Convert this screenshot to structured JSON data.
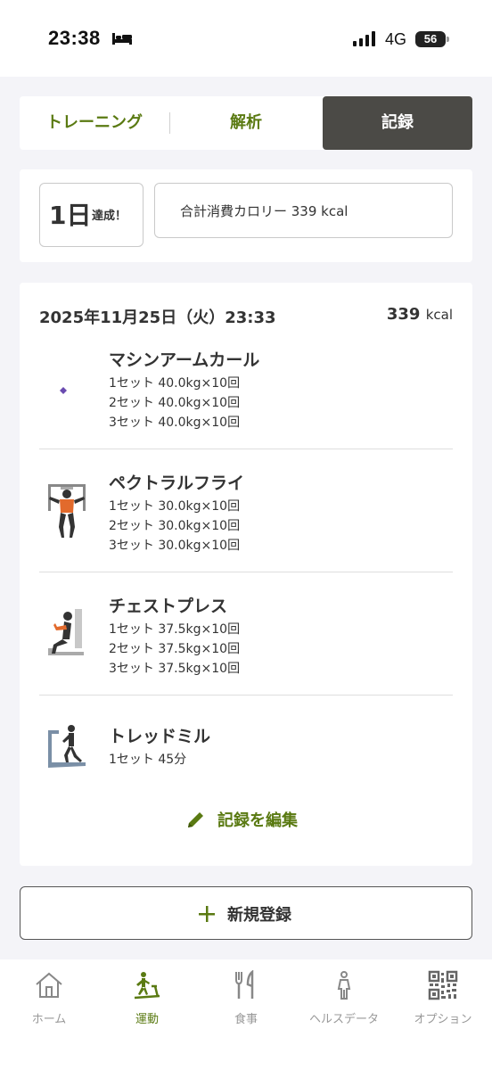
{
  "status_bar": {
    "time": "23:38",
    "network": "4G",
    "battery": "56",
    "icons": [
      "bed-icon",
      "signal-icon",
      "battery-icon"
    ]
  },
  "tabs": [
    {
      "label": "トレーニング",
      "active": false
    },
    {
      "label": "解析",
      "active": false
    },
    {
      "label": "記録",
      "active": true
    }
  ],
  "achievement": {
    "days": "1日",
    "suffix": "達成！",
    "calories_text": "合計消費カロリー 339 kcal"
  },
  "record": {
    "datetime": "2025年11月25日（火）23:33",
    "kcal_value": "339",
    "kcal_unit": "kcal",
    "exercises": [
      {
        "name": "マシンアームカール",
        "icon": "arm-curl-icon",
        "sets": [
          "1セット 40.0kg×10回",
          "2セット 40.0kg×10回",
          "3セット 40.0kg×10回"
        ]
      },
      {
        "name": "ペクトラルフライ",
        "icon": "pectoral-fly-icon",
        "sets": [
          "1セット 30.0kg×10回",
          "2セット 30.0kg×10回",
          "3セット 30.0kg×10回"
        ]
      },
      {
        "name": "チェストプレス",
        "icon": "chest-press-icon",
        "sets": [
          "1セット 37.5kg×10回",
          "2セット 37.5kg×10回",
          "3セット 37.5kg×10回"
        ]
      },
      {
        "name": "トレッドミル",
        "icon": "treadmill-icon",
        "sets": [
          "1セット 45分"
        ]
      }
    ],
    "edit_label": "記録を編集"
  },
  "new_button_label": "新規登録",
  "accent_color": "#5a7a12",
  "nav": [
    {
      "label": "ホーム",
      "icon": "home-icon",
      "active": false
    },
    {
      "label": "運動",
      "icon": "exercise-icon",
      "active": true
    },
    {
      "label": "食事",
      "icon": "meal-icon",
      "active": false
    },
    {
      "label": "ヘルスデータ",
      "icon": "health-icon",
      "active": false
    },
    {
      "label": "オプション",
      "icon": "qr-icon",
      "active": false
    }
  ]
}
